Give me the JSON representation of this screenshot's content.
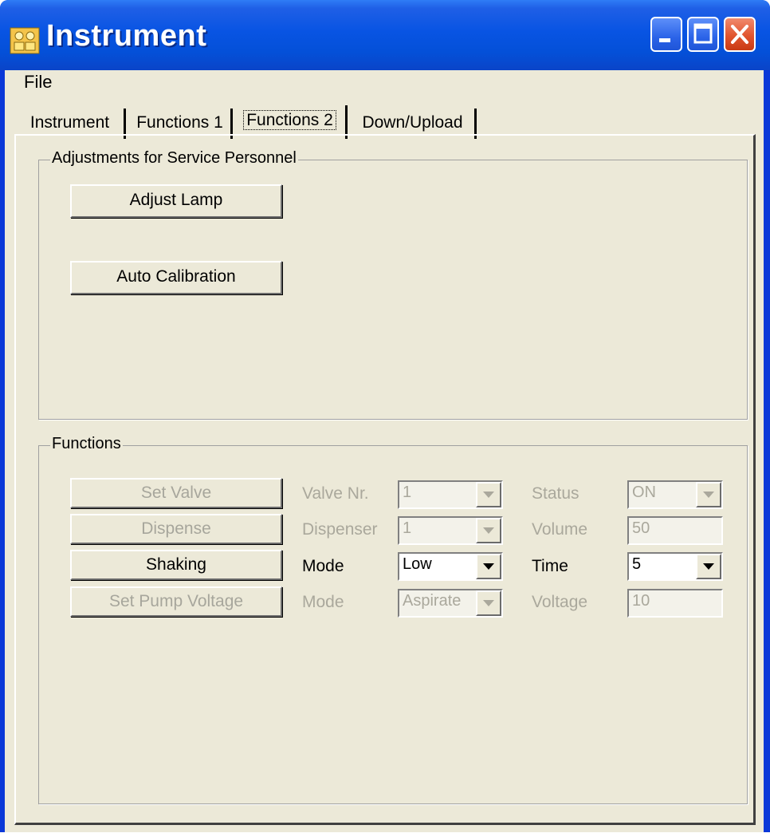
{
  "window": {
    "title": "Instrument"
  },
  "menu": {
    "file": "File"
  },
  "tabs": [
    {
      "label": "Instrument",
      "active": false
    },
    {
      "label": "Functions 1",
      "active": false
    },
    {
      "label": "Functions 2",
      "active": true
    },
    {
      "label": "Down/Upload",
      "active": false
    }
  ],
  "service": {
    "title": "Adjustments for Service Personnel",
    "adjust_lamp": "Adjust Lamp",
    "auto_calibration": "Auto Calibration"
  },
  "functions": {
    "title": "Functions",
    "rows": [
      {
        "button": "Set Valve",
        "label1": "Valve Nr.",
        "value1": "1",
        "label2": "Status",
        "value2": "ON",
        "enabled": false
      },
      {
        "button": "Dispense",
        "label1": "Dispenser",
        "value1": "1",
        "label2": "Volume",
        "value2": "50",
        "enabled": false
      },
      {
        "button": "Shaking",
        "label1": "Mode",
        "value1": "Low",
        "label2": "Time",
        "value2": "5",
        "enabled": true
      },
      {
        "button": "Set Pump Voltage",
        "label1": "Mode",
        "value1": "Aspirate",
        "label2": "Voltage",
        "value2": "10",
        "enabled": false
      }
    ]
  },
  "colors": {
    "titlebar": "#0854e3",
    "face": "#ece9d8",
    "disabled_text": "#a7a69c",
    "close_button": "#e1542e"
  }
}
